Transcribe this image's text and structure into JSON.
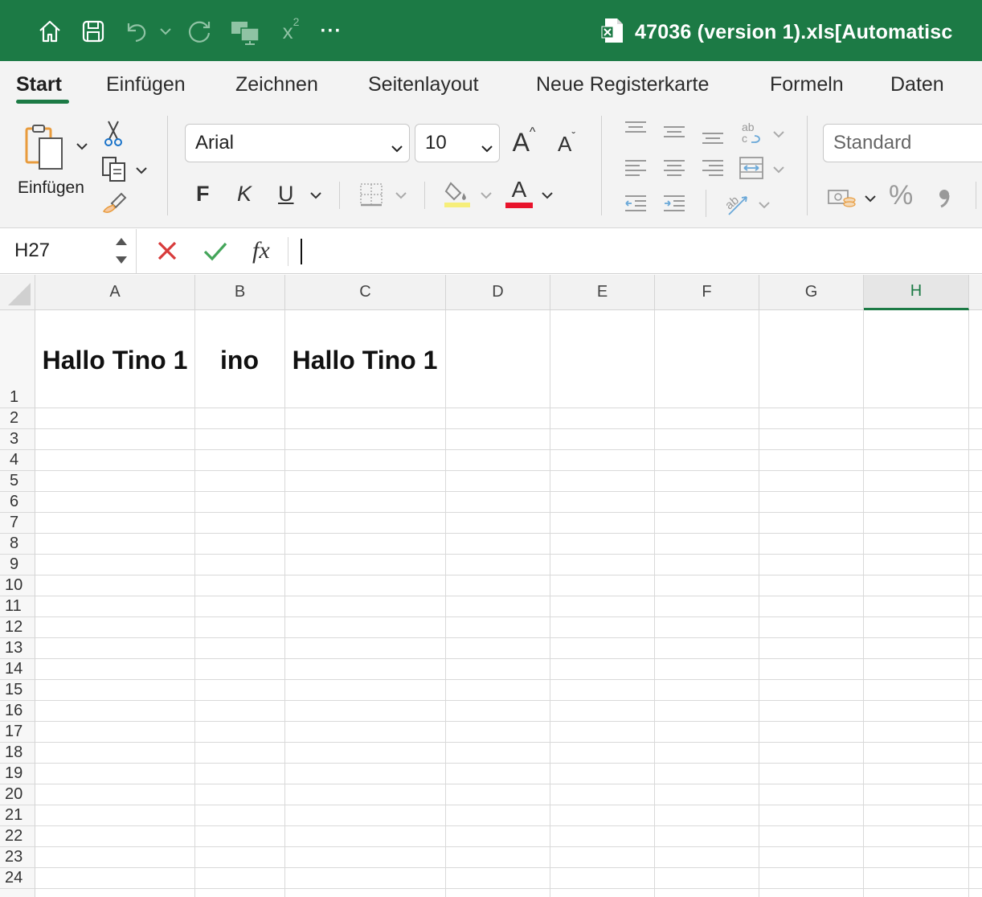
{
  "title_bar": {
    "document_title": "47036 (version 1).xls[Automatisc",
    "background_color": "#1c7a45",
    "quick_access_icons": [
      "home-icon",
      "save-icon",
      "undo-icon",
      "undo-dropdown-icon",
      "redo-icon",
      "presentation-icon",
      "superscript-icon",
      "more-icon"
    ],
    "superscript_label": "x",
    "superscript_sup": "2",
    "more_label": "···"
  },
  "ribbon": {
    "tabs": [
      {
        "label": "Start",
        "active": true
      },
      {
        "label": "Einfügen",
        "active": false
      },
      {
        "label": "Zeichnen",
        "active": false
      },
      {
        "label": "Seitenlayout",
        "active": false
      },
      {
        "label": "Neue Registerkarte",
        "active": false
      },
      {
        "label": "Formeln",
        "active": false
      },
      {
        "label": "Daten",
        "active": false
      }
    ],
    "clipboard": {
      "paste_label": "Einfügen"
    },
    "font": {
      "family": "Arial",
      "size": "10",
      "bold_label": "F",
      "italic_label": "K",
      "underline_label": "U",
      "increase_label": "A",
      "decrease_label": "A",
      "font_color_label": "A",
      "font_color": "#e8132b",
      "highlight_color": "#f6ee7a"
    },
    "number": {
      "format": "Standard",
      "percent_label": "%"
    }
  },
  "formula_bar": {
    "name_box": "H27",
    "cancel_icon": "close-icon",
    "confirm_icon": "check-icon",
    "function_label": "fx",
    "formula": ""
  },
  "sheet": {
    "columns": [
      "A",
      "B",
      "C",
      "D",
      "E",
      "F",
      "G",
      "H"
    ],
    "selected_column": "H",
    "rows": [
      "1",
      "2",
      "3",
      "4",
      "5",
      "6",
      "7",
      "8",
      "9",
      "10",
      "11",
      "12",
      "13",
      "14",
      "15",
      "16",
      "17",
      "18",
      "19",
      "20",
      "21",
      "22",
      "23",
      "24"
    ],
    "cells": {
      "A1": "Hallo Tino 1",
      "B1": "ino",
      "C1": "Hallo Tino 1"
    }
  }
}
